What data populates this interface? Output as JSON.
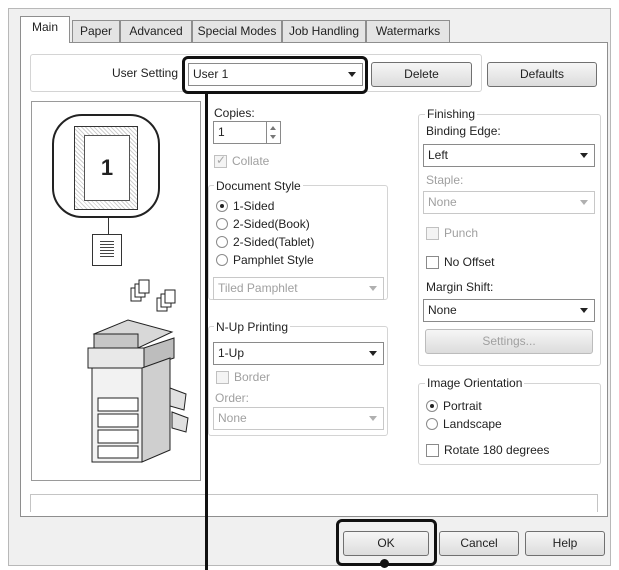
{
  "tabs": [
    "Main",
    "Paper",
    "Advanced",
    "Special Modes",
    "Job Handling",
    "Watermarks"
  ],
  "user_setting": {
    "label": "User Setting",
    "value": "User 1",
    "delete": "Delete",
    "defaults": "Defaults"
  },
  "preview": {
    "page_number": "1"
  },
  "copies": {
    "label": "Copies:",
    "value": "1",
    "collate": "Collate",
    "collate_checked": true
  },
  "document_style": {
    "title": "Document Style",
    "options": [
      "1-Sided",
      "2-Sided(Book)",
      "2-Sided(Tablet)",
      "Pamphlet Style"
    ],
    "selected": "1-Sided",
    "pamphlet_value": "Tiled Pamphlet"
  },
  "nup": {
    "title": "N-Up Printing",
    "value": "1-Up",
    "border": "Border",
    "order_label": "Order:",
    "order_value": "None"
  },
  "finishing": {
    "title": "Finishing",
    "binding_label": "Binding Edge:",
    "binding_value": "Left",
    "staple_label": "Staple:",
    "staple_value": "None",
    "punch": "Punch",
    "no_offset": "No Offset",
    "margin_label": "Margin Shift:",
    "margin_value": "None",
    "settings": "Settings..."
  },
  "orientation": {
    "title": "Image Orientation",
    "portrait": "Portrait",
    "landscape": "Landscape",
    "rotate": "Rotate 180 degrees",
    "selected": "Portrait"
  },
  "buttons": {
    "ok": "OK",
    "cancel": "Cancel",
    "help": "Help"
  }
}
